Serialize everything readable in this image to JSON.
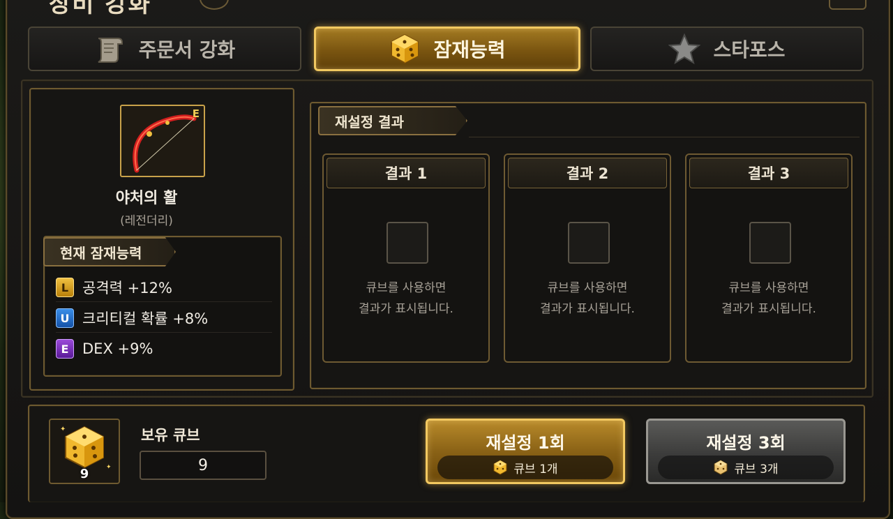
{
  "window": {
    "title": "장비 강화"
  },
  "tabs": [
    {
      "label": "주문서 강화",
      "icon": "scroll-icon",
      "active": false
    },
    {
      "label": "잠재능력",
      "icon": "cube-icon",
      "active": true
    },
    {
      "label": "스타포스",
      "icon": "star-icon",
      "active": false
    }
  ],
  "item": {
    "name": "야처의 활",
    "rarity": "(레전더리)",
    "grade_mark": "E",
    "icon": "bow-icon"
  },
  "current_potential": {
    "header": "현재 잠재능력",
    "stats": [
      {
        "grade": "L",
        "text": "공격력 +12%"
      },
      {
        "grade": "U",
        "text": "크리티컬 확률 +8%"
      },
      {
        "grade": "E",
        "text": "DEX +9%"
      }
    ]
  },
  "reset_results": {
    "header": "재설정 결과",
    "cards": [
      {
        "title": "결과 1",
        "message_line1": "큐브를 사용하면",
        "message_line2": "결과가 표시됩니다."
      },
      {
        "title": "결과 2",
        "message_line1": "큐브를 사용하면",
        "message_line2": "결과가 표시됩니다."
      },
      {
        "title": "결과 3",
        "message_line1": "큐브를 사용하면",
        "message_line2": "결과가 표시됩니다."
      }
    ]
  },
  "cubes": {
    "label": "보유 큐브",
    "badge_count": "9",
    "field_value": "9"
  },
  "actions": {
    "reset_once": {
      "label": "재설정 1회",
      "cost": "큐브 1개"
    },
    "reset_thrice": {
      "label": "재설정 3회",
      "cost": "큐브 3개"
    }
  },
  "colors": {
    "accent_gold": "#f1c860",
    "grade_legendary": "#f0c040",
    "grade_unique": "#3a8ee8",
    "grade_epic": "#9a4ad8"
  }
}
